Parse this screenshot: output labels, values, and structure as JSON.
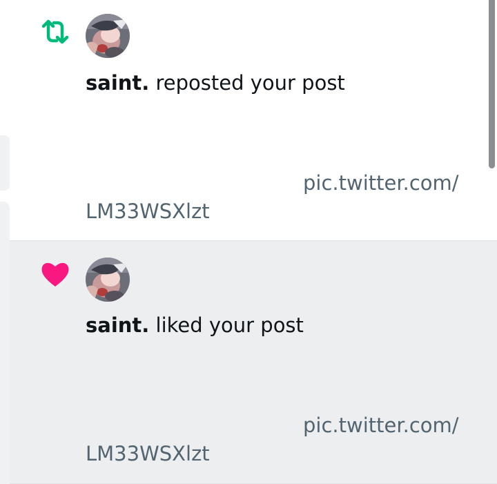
{
  "notifications": [
    {
      "type": "repost",
      "icon": "repost-icon",
      "icon_color": "#00ba7c",
      "username": "saint.",
      "action_text": " reposted your post",
      "link_line_1": "pic.twitter.com/",
      "link_line_2": "LM33WSXlzt"
    },
    {
      "type": "like",
      "icon": "heart-icon",
      "icon_color": "#f91880",
      "username": "saint.",
      "action_text": " liked your post",
      "link_line_1": "pic.twitter.com/",
      "link_line_2": "LM33WSXlzt"
    }
  ],
  "colors": {
    "text_primary": "#0f1419",
    "text_secondary": "#536471",
    "highlight_background": "#eceef0"
  }
}
